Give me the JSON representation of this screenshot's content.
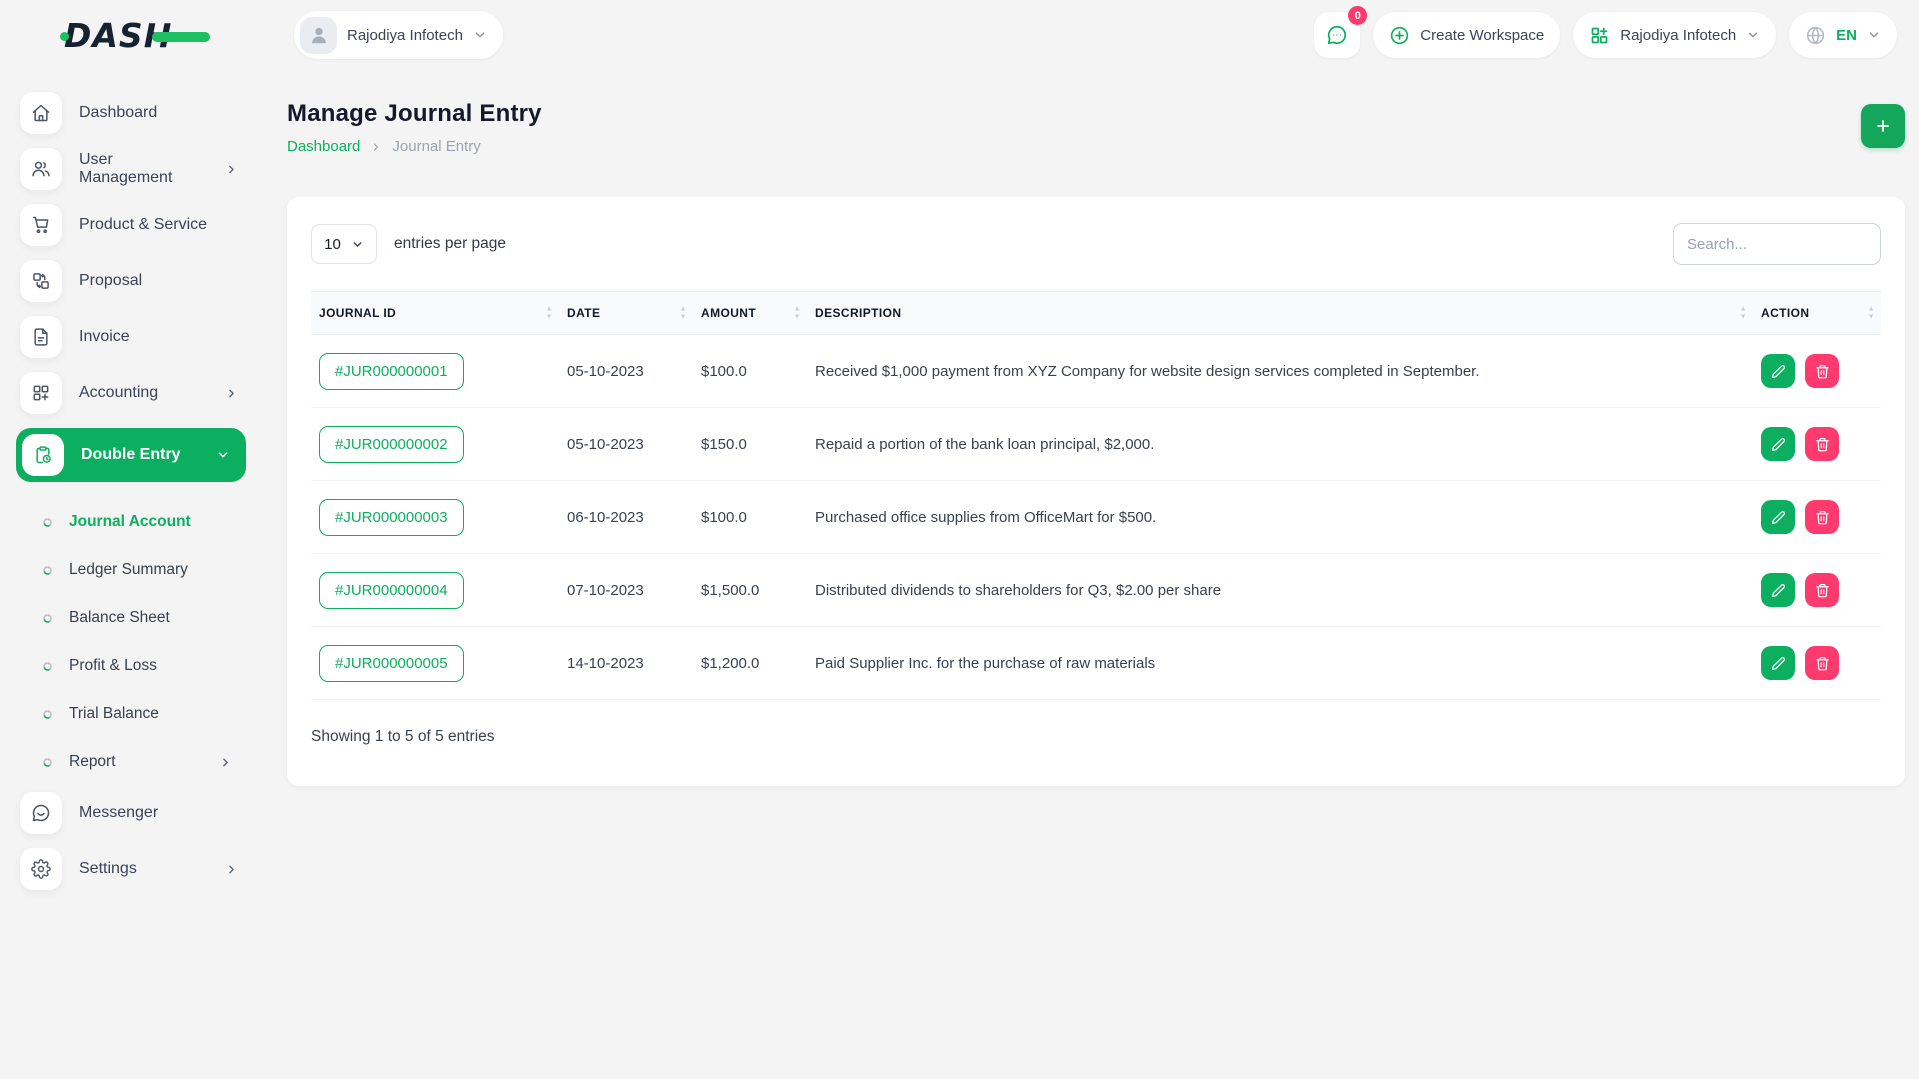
{
  "colors": {
    "primary_green": "#0CAF60",
    "danger_pink": "#FF3A6E",
    "logo_green": "#1EBE62"
  },
  "brand": {
    "logo_text": "DASH"
  },
  "topbar": {
    "workspace": {
      "name": "Rajodiya Infotech",
      "icon": "avatar-person-icon"
    },
    "messages": {
      "icon": "chat-bubble-icon",
      "badge_count": "0"
    },
    "create_workspace": {
      "label": "Create Workspace",
      "icon": "circle-plus-icon"
    },
    "company": {
      "name": "Rajodiya Infotech",
      "icon": "workspace-grid-icon"
    },
    "language": {
      "code": "EN",
      "icon": "globe-icon"
    }
  },
  "sidebar": {
    "items": [
      {
        "label": "Dashboard",
        "icon": "home-icon"
      },
      {
        "label": "User Management",
        "icon": "users-icon",
        "has_submenu": true
      },
      {
        "label": "Product & Service",
        "icon": "cart-icon"
      },
      {
        "label": "Proposal",
        "icon": "swap-boxes-icon"
      },
      {
        "label": "Invoice",
        "icon": "invoice-file-icon"
      },
      {
        "label": "Accounting",
        "icon": "grid-plus-icon",
        "has_submenu": true
      },
      {
        "label": "Double Entry",
        "icon": "clipboard-clock-icon",
        "active": true,
        "expanded": true
      }
    ],
    "double_entry_submenu": [
      {
        "label": "Journal Account",
        "active": true
      },
      {
        "label": "Ledger Summary"
      },
      {
        "label": "Balance Sheet"
      },
      {
        "label": "Profit & Loss"
      },
      {
        "label": "Trial Balance"
      },
      {
        "label": "Report",
        "has_submenu": true
      }
    ],
    "footer_items": [
      {
        "label": "Messenger",
        "icon": "messenger-icon"
      },
      {
        "label": "Settings",
        "icon": "gear-icon",
        "has_submenu": true
      }
    ]
  },
  "page": {
    "title": "Manage Journal Entry",
    "breadcrumb": {
      "home": "Dashboard",
      "current": "Journal Entry"
    }
  },
  "controls": {
    "entries_per_page_value": "10",
    "entries_per_page_label": "entries per page",
    "search_placeholder": "Search..."
  },
  "table": {
    "headers": [
      "JOURNAL ID",
      "DATE",
      "AMOUNT",
      "DESCRIPTION",
      "ACTION"
    ],
    "rows": [
      {
        "journal_id": "#JUR000000001",
        "date": "05-10-2023",
        "amount": "$100.0",
        "description": "Received $1,000 payment from XYZ Company for website design services completed in September."
      },
      {
        "journal_id": "#JUR000000002",
        "date": "05-10-2023",
        "amount": "$150.0",
        "description": "Repaid a portion of the bank loan principal, $2,000."
      },
      {
        "journal_id": "#JUR000000003",
        "date": "06-10-2023",
        "amount": "$100.0",
        "description": "Purchased office supplies from OfficeMart for $500."
      },
      {
        "journal_id": "#JUR000000004",
        "date": "07-10-2023",
        "amount": "$1,500.0",
        "description": "Distributed dividends to shareholders for Q3, $2.00 per share"
      },
      {
        "journal_id": "#JUR000000005",
        "date": "14-10-2023",
        "amount": "$1,200.0",
        "description": "Paid Supplier Inc. for the purchase of raw materials"
      }
    ],
    "summary": "Showing 1 to 5 of 5 entries"
  }
}
